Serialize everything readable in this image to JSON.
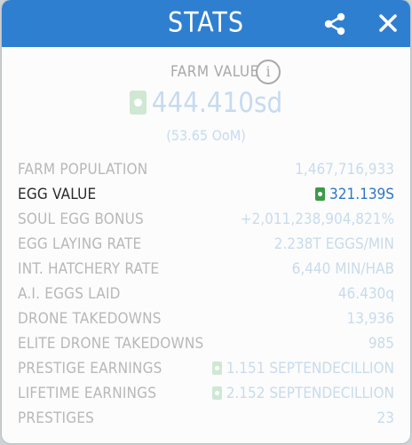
{
  "header": {
    "title": "STATS",
    "share_icon": "share-icon",
    "close_icon": "close-icon"
  },
  "farm_value": {
    "label": "FARM VALUE",
    "info_icon": "info-icon",
    "info_glyph": "i",
    "value": "444.410sd",
    "sub_value": "(53.65 OoM)"
  },
  "stats": [
    {
      "label": "FARM POPULATION",
      "value": "1,467,716,933"
    },
    {
      "label": "EGG VALUE",
      "value": "321.139S",
      "icon": "money-bill-icon",
      "highlight": true
    },
    {
      "label": "SOUL EGG BONUS",
      "value": "+2,011,238,904,821%"
    },
    {
      "label": "EGG LAYING RATE",
      "value": "2.238T EGGS/MIN"
    },
    {
      "label": "INT. HATCHERY RATE",
      "value": "6,440 MIN/HAB"
    },
    {
      "label": "A.I. EGGS LAID",
      "value": "46.430q"
    },
    {
      "label": "DRONE TAKEDOWNS",
      "value": "13,936"
    },
    {
      "label": "ELITE DRONE TAKEDOWNS",
      "value": "985"
    },
    {
      "label": "PRESTIGE EARNINGS",
      "value": "1.151 SEPTENDECILLION",
      "icon": "money-bill-icon"
    },
    {
      "label": "LIFETIME EARNINGS",
      "value": "2.152 SEPTENDECILLION",
      "icon": "money-bill-icon"
    },
    {
      "label": "PRESTIGES",
      "value": "23"
    }
  ],
  "colors": {
    "header_bg": "#2f7fd1",
    "label_dim": "#b8b8b8",
    "value_dim": "#c9dbec",
    "highlight_label": "#2b2b2b",
    "highlight_value": "#2f76c7",
    "money_green": "#3c9a4a"
  }
}
